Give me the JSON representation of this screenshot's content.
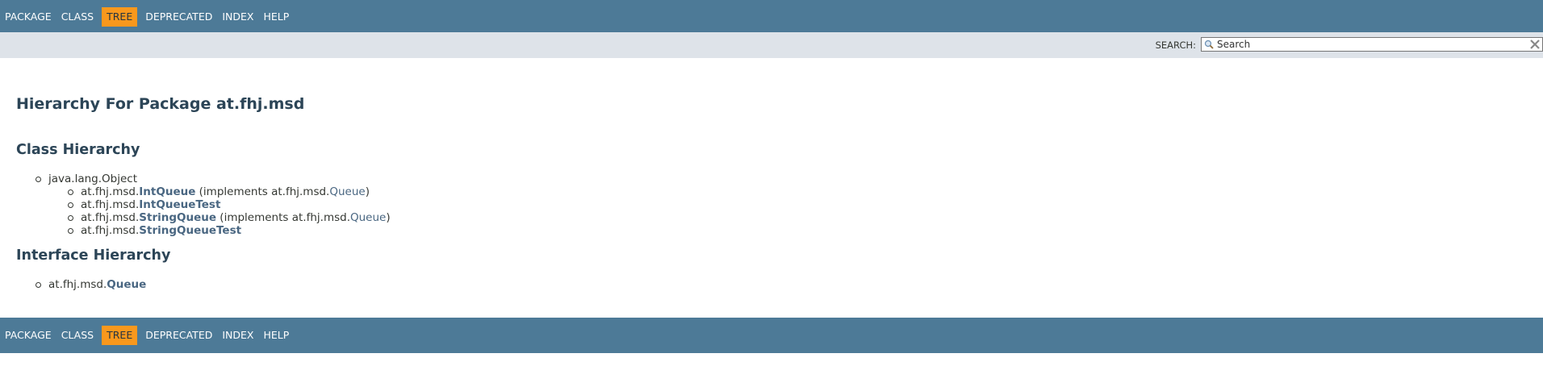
{
  "nav": {
    "items": [
      {
        "label": "Package",
        "active": false
      },
      {
        "label": "Class",
        "active": false
      },
      {
        "label": "Tree",
        "active": true
      },
      {
        "label": "Deprecated",
        "active": false
      },
      {
        "label": "Index",
        "active": false
      },
      {
        "label": "Help",
        "active": false
      }
    ]
  },
  "search": {
    "label": "SEARCH:",
    "placeholder": "Search",
    "value": ""
  },
  "page_title": "Hierarchy For Package at.fhj.msd",
  "class_hierarchy": {
    "heading": "Class Hierarchy",
    "root": "java.lang.Object",
    "children": [
      {
        "pkg": "at.fhj.msd.",
        "name": "IntQueue",
        "impl_prefix": " (implements at.fhj.msd.",
        "impl_name": "Queue",
        "impl_suffix": ")"
      },
      {
        "pkg": "at.fhj.msd.",
        "name": "IntQueueTest"
      },
      {
        "pkg": "at.fhj.msd.",
        "name": "StringQueue",
        "impl_prefix": " (implements at.fhj.msd.",
        "impl_name": "Queue",
        "impl_suffix": ")"
      },
      {
        "pkg": "at.fhj.msd.",
        "name": "StringQueueTest"
      }
    ]
  },
  "interface_hierarchy": {
    "heading": "Interface Hierarchy",
    "items": [
      {
        "pkg": "at.fhj.msd.",
        "name": "Queue"
      }
    ]
  },
  "icons": {
    "search": "magnifier-icon",
    "reset": "close-x-icon"
  },
  "colors": {
    "navbar": "#4d7a97",
    "active_tab": "#f8981d",
    "subnav": "#dee3e9",
    "link": "#4a6782",
    "heading": "#2c4557"
  }
}
